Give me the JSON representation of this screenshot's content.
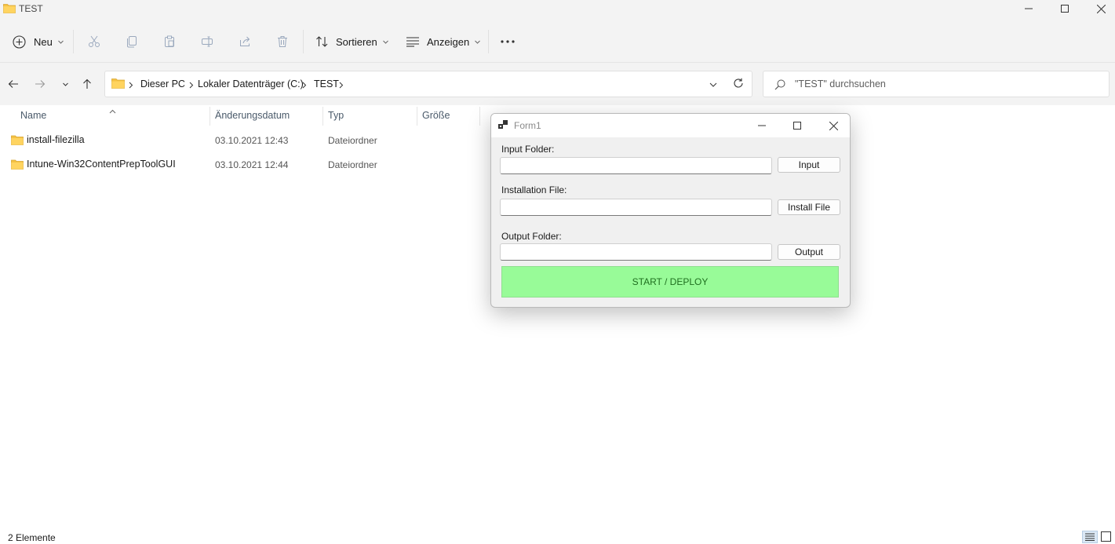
{
  "window": {
    "title": "TEST"
  },
  "toolbar": {
    "new_label": "Neu",
    "sort_label": "Sortieren",
    "view_label": "Anzeigen",
    "icons": [
      "cut-icon",
      "copy-icon",
      "paste-icon",
      "rename-icon",
      "share-icon",
      "delete-icon"
    ]
  },
  "address": {
    "crumbs": [
      "Dieser PC",
      "Lokaler Datenträger (C:)",
      "TEST"
    ]
  },
  "search": {
    "placeholder": "\"TEST\" durchsuchen"
  },
  "columns": [
    "Name",
    "Änderungsdatum",
    "Typ",
    "Größe"
  ],
  "files": [
    {
      "name": "install-filezilla",
      "date": "03.10.2021 12:43",
      "type": "Dateiordner"
    },
    {
      "name": "Intune-Win32ContentPrepToolGUI",
      "date": "03.10.2021 12:44",
      "type": "Dateiordner"
    }
  ],
  "status": {
    "count": "2 Elemente"
  },
  "form": {
    "title": "Form1",
    "input_label": "Input Folder:",
    "input_button": "Input",
    "install_label": "Installation File:",
    "install_button": "Install File",
    "output_label": "Output Folder:",
    "output_button": "Output",
    "deploy_button": "START / DEPLOY",
    "deploy_color": "#98fb98"
  },
  "colors": {
    "folder": "#f5c244",
    "chrome": "#f3f3f3"
  }
}
